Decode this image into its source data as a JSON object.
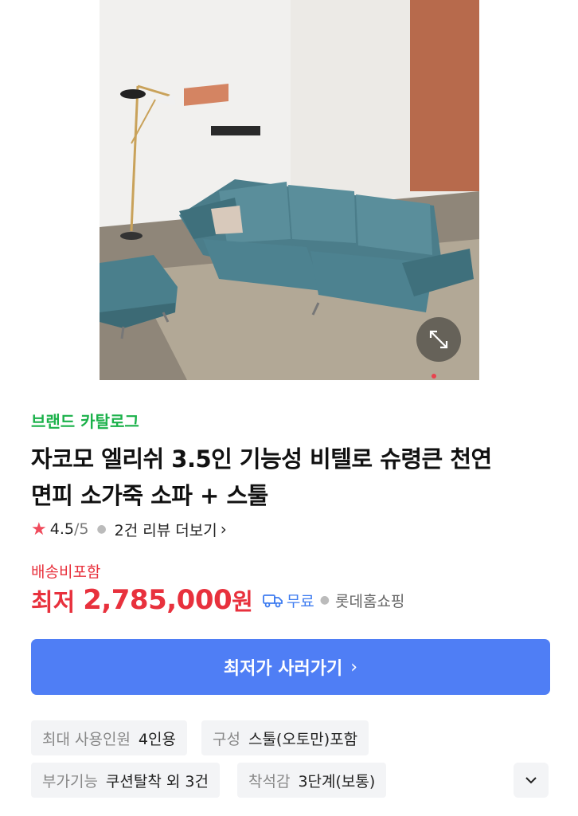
{
  "product": {
    "brand_catalog": "브랜드 카탈로그",
    "title_line1": "자코모 엘리쉬 3.5인 기능성 비텔로 슈령큰 천연",
    "title_line2": "면피 소가죽 소파 + 스툴",
    "rating": "4.5",
    "rating_max": "/5",
    "review_link": "2건 리뷰 더보기",
    "shipping_label": "배송비포함",
    "price_prefix": "최저",
    "price_value": "2,785,000",
    "price_unit": "원",
    "delivery_free": "무료",
    "seller": "롯데홈쇼핑",
    "cta_label": "최저가 사러가기",
    "specs": [
      {
        "key": "최대 사용인원",
        "value": "4인용"
      },
      {
        "key": "구성",
        "value": "스툴(오토만)포함"
      },
      {
        "key": "부가기능",
        "value": "쿠션탈착 외 3건"
      },
      {
        "key": "착석감",
        "value": "3단계(보통)"
      }
    ]
  },
  "icons": {
    "zoom": "expand-arrows-icon",
    "star": "star-icon",
    "truck": "delivery-truck-icon",
    "chevron": "chevron-right-icon",
    "expand": "chevron-down-icon"
  },
  "colors": {
    "brand_green": "#1bb14a",
    "price_red": "#e8313d",
    "cta_blue": "#4f7ef5",
    "free_blue": "#3e7cf0",
    "star_red": "#f04b5c"
  }
}
